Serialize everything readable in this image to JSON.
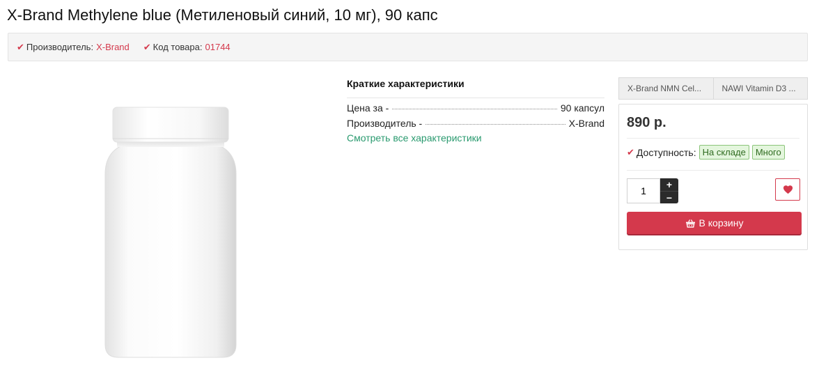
{
  "product": {
    "title": "X-Brand Methylene blue (Метиленовый синий, 10 мг), 90 капс"
  },
  "meta": {
    "manufacturer_label": "Производитель:",
    "manufacturer_value": "X-Brand",
    "code_label": "Код товара:",
    "code_value": "01744"
  },
  "specs": {
    "title": "Краткие характеристики",
    "rows": [
      {
        "label": "Цена за -",
        "value": "90 капсул"
      },
      {
        "label": "Производитель -",
        "value": "X-Brand"
      }
    ],
    "all_link": "Смотреть все характеристики"
  },
  "tabs": [
    {
      "label": "X-Brand NMN Cel..."
    },
    {
      "label": "NAWI Vitamin D3 ..."
    }
  ],
  "buy": {
    "price": "890 р.",
    "availability_label": "Доступность:",
    "stock_badge": "На складе",
    "amount_badge": "Много",
    "quantity": "1",
    "plus": "+",
    "minus": "−",
    "cart_label": "В корзину"
  },
  "icons": {
    "check": "check-icon",
    "heart": "heart-icon",
    "basket": "basket-icon"
  },
  "colors": {
    "accent": "#d4394c",
    "link_green": "#2a9a6f",
    "stock_bg": "#e4f6dd"
  }
}
